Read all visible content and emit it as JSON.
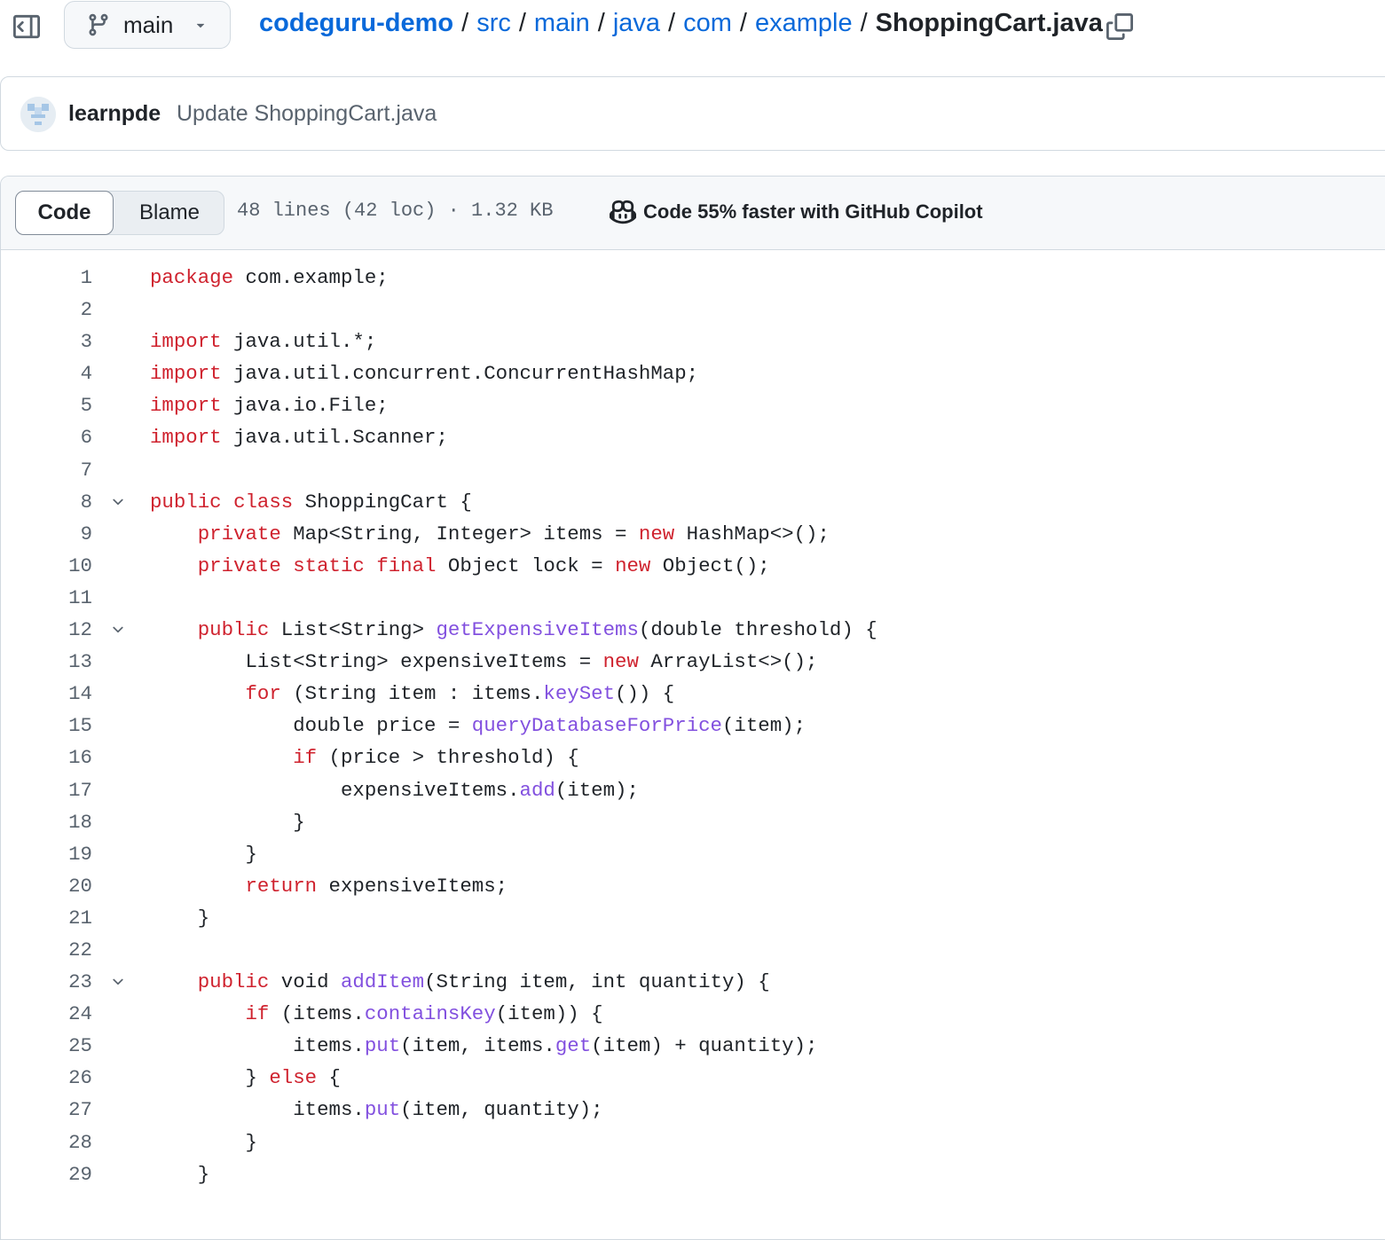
{
  "branch": {
    "name": "main"
  },
  "breadcrumb": {
    "repo": "codeguru-demo",
    "dirs": [
      "src",
      "main",
      "java",
      "com",
      "example"
    ],
    "separator": "/",
    "file": "ShoppingCart.java"
  },
  "commit": {
    "author": "learnpde",
    "message": "Update ShoppingCart.java"
  },
  "file_header": {
    "tabs": {
      "code": "Code",
      "blame": "Blame"
    },
    "meta": "48 lines (42 loc) · 1.32 KB",
    "copilot": "Code 55% faster with GitHub Copilot"
  },
  "colors": {
    "link": "#0969da",
    "keyword": "#cf222e",
    "function": "#8250df",
    "text": "#1f2328",
    "muted": "#59636e",
    "border": "#d1d9e0"
  },
  "icons": [
    "sidebar-toggle-icon",
    "git-branch-icon",
    "triangle-down-icon",
    "copy-icon",
    "copilot-icon",
    "chevron-down-icon"
  ],
  "code": {
    "lines": [
      {
        "n": "1",
        "fold": false,
        "t": [
          [
            "kw",
            "package"
          ],
          [
            "pl",
            " com.example;"
          ]
        ]
      },
      {
        "n": "2",
        "fold": false,
        "t": []
      },
      {
        "n": "3",
        "fold": false,
        "t": [
          [
            "kw",
            "import"
          ],
          [
            "pl",
            " java.util.*;"
          ]
        ]
      },
      {
        "n": "4",
        "fold": false,
        "t": [
          [
            "kw",
            "import"
          ],
          [
            "pl",
            " java.util.concurrent.ConcurrentHashMap;"
          ]
        ]
      },
      {
        "n": "5",
        "fold": false,
        "t": [
          [
            "kw",
            "import"
          ],
          [
            "pl",
            " java.io.File;"
          ]
        ]
      },
      {
        "n": "6",
        "fold": false,
        "t": [
          [
            "kw",
            "import"
          ],
          [
            "pl",
            " java.util.Scanner;"
          ]
        ]
      },
      {
        "n": "7",
        "fold": false,
        "t": []
      },
      {
        "n": "8",
        "fold": true,
        "t": [
          [
            "kw",
            "public"
          ],
          [
            "pl",
            " "
          ],
          [
            "kw",
            "class"
          ],
          [
            "pl",
            " ShoppingCart {"
          ]
        ]
      },
      {
        "n": "9",
        "fold": false,
        "t": [
          [
            "pl",
            "    "
          ],
          [
            "kw",
            "private"
          ],
          [
            "pl",
            " Map<String, Integer> items = "
          ],
          [
            "kw",
            "new"
          ],
          [
            "pl",
            " HashMap<>();"
          ]
        ]
      },
      {
        "n": "10",
        "fold": false,
        "t": [
          [
            "pl",
            "    "
          ],
          [
            "kw",
            "private"
          ],
          [
            "pl",
            " "
          ],
          [
            "kw",
            "static"
          ],
          [
            "pl",
            " "
          ],
          [
            "kw",
            "final"
          ],
          [
            "pl",
            " Object lock = "
          ],
          [
            "kw",
            "new"
          ],
          [
            "pl",
            " Object();"
          ]
        ]
      },
      {
        "n": "11",
        "fold": false,
        "t": []
      },
      {
        "n": "12",
        "fold": true,
        "t": [
          [
            "pl",
            "    "
          ],
          [
            "kw",
            "public"
          ],
          [
            "pl",
            " List<String> "
          ],
          [
            "fn",
            "getExpensiveItems"
          ],
          [
            "pl",
            "(double threshold) {"
          ]
        ]
      },
      {
        "n": "13",
        "fold": false,
        "t": [
          [
            "pl",
            "        List<String> expensiveItems = "
          ],
          [
            "kw",
            "new"
          ],
          [
            "pl",
            " ArrayList<>();"
          ]
        ]
      },
      {
        "n": "14",
        "fold": false,
        "t": [
          [
            "pl",
            "        "
          ],
          [
            "kw",
            "for"
          ],
          [
            "pl",
            " (String item : items."
          ],
          [
            "fn",
            "keySet"
          ],
          [
            "pl",
            "()) {"
          ]
        ]
      },
      {
        "n": "15",
        "fold": false,
        "t": [
          [
            "pl",
            "            double price = "
          ],
          [
            "fn",
            "queryDatabaseForPrice"
          ],
          [
            "pl",
            "(item);"
          ]
        ]
      },
      {
        "n": "16",
        "fold": false,
        "t": [
          [
            "pl",
            "            "
          ],
          [
            "kw",
            "if"
          ],
          [
            "pl",
            " (price > threshold) {"
          ]
        ]
      },
      {
        "n": "17",
        "fold": false,
        "t": [
          [
            "pl",
            "                expensiveItems."
          ],
          [
            "fn",
            "add"
          ],
          [
            "pl",
            "(item);"
          ]
        ]
      },
      {
        "n": "18",
        "fold": false,
        "t": [
          [
            "pl",
            "            }"
          ]
        ]
      },
      {
        "n": "19",
        "fold": false,
        "t": [
          [
            "pl",
            "        }"
          ]
        ]
      },
      {
        "n": "20",
        "fold": false,
        "t": [
          [
            "pl",
            "        "
          ],
          [
            "kw",
            "return"
          ],
          [
            "pl",
            " expensiveItems;"
          ]
        ]
      },
      {
        "n": "21",
        "fold": false,
        "t": [
          [
            "pl",
            "    }"
          ]
        ]
      },
      {
        "n": "22",
        "fold": false,
        "t": []
      },
      {
        "n": "23",
        "fold": true,
        "t": [
          [
            "pl",
            "    "
          ],
          [
            "kw",
            "public"
          ],
          [
            "pl",
            " void "
          ],
          [
            "fn",
            "addItem"
          ],
          [
            "pl",
            "(String item, int quantity) {"
          ]
        ]
      },
      {
        "n": "24",
        "fold": false,
        "t": [
          [
            "pl",
            "        "
          ],
          [
            "kw",
            "if"
          ],
          [
            "pl",
            " (items."
          ],
          [
            "fn",
            "containsKey"
          ],
          [
            "pl",
            "(item)) {"
          ]
        ]
      },
      {
        "n": "25",
        "fold": false,
        "t": [
          [
            "pl",
            "            items."
          ],
          [
            "fn",
            "put"
          ],
          [
            "pl",
            "(item, items."
          ],
          [
            "fn",
            "get"
          ],
          [
            "pl",
            "(item) + quantity);"
          ]
        ]
      },
      {
        "n": "26",
        "fold": false,
        "t": [
          [
            "pl",
            "        } "
          ],
          [
            "kw",
            "else"
          ],
          [
            "pl",
            " {"
          ]
        ]
      },
      {
        "n": "27",
        "fold": false,
        "t": [
          [
            "pl",
            "            items."
          ],
          [
            "fn",
            "put"
          ],
          [
            "pl",
            "(item, quantity);"
          ]
        ]
      },
      {
        "n": "28",
        "fold": false,
        "t": [
          [
            "pl",
            "        }"
          ]
        ]
      },
      {
        "n": "29",
        "fold": false,
        "t": [
          [
            "pl",
            "    }"
          ]
        ]
      }
    ]
  }
}
